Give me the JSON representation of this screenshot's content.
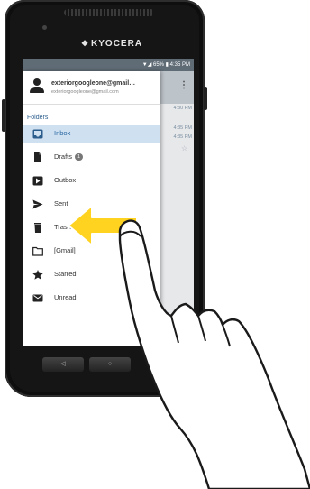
{
  "device": {
    "brand": "KYOCERA",
    "brand_logo": "kyocera-logo-icon"
  },
  "status_bar": {
    "text": "▼◢ 65% ▮ 4:35 PM"
  },
  "account": {
    "name": "exteriorgoogleone@gmail…",
    "email": "exteriorgoogleone@gmail.com"
  },
  "drawer": {
    "section_label": "Folders",
    "items": [
      {
        "label": "Inbox",
        "icon": "inbox-icon",
        "active": true
      },
      {
        "label": "Drafts",
        "icon": "draft-file-icon",
        "badge": "1"
      },
      {
        "label": "Outbox",
        "icon": "outbox-icon"
      },
      {
        "label": "Sent",
        "icon": "send-icon"
      },
      {
        "label": "Trash",
        "icon": "trash-icon"
      },
      {
        "label": "[Gmail]",
        "icon": "folder-icon"
      },
      {
        "label": "Starred",
        "icon": "star-icon"
      },
      {
        "label": "Unread",
        "icon": "envelope-icon"
      }
    ]
  },
  "background_list": {
    "times": [
      "4:30 PM",
      "4:35 PM",
      "4:35 PM"
    ]
  },
  "nav": {
    "back": "◁",
    "home": "○"
  },
  "gesture": {
    "direction": "left",
    "arrow_color": "#ffd320",
    "arrow_outline": "#ffffff"
  },
  "colors": {
    "active_row": "#cfe0f0",
    "accent": "#2b6aa3",
    "status_bar": "#5f6b75"
  }
}
